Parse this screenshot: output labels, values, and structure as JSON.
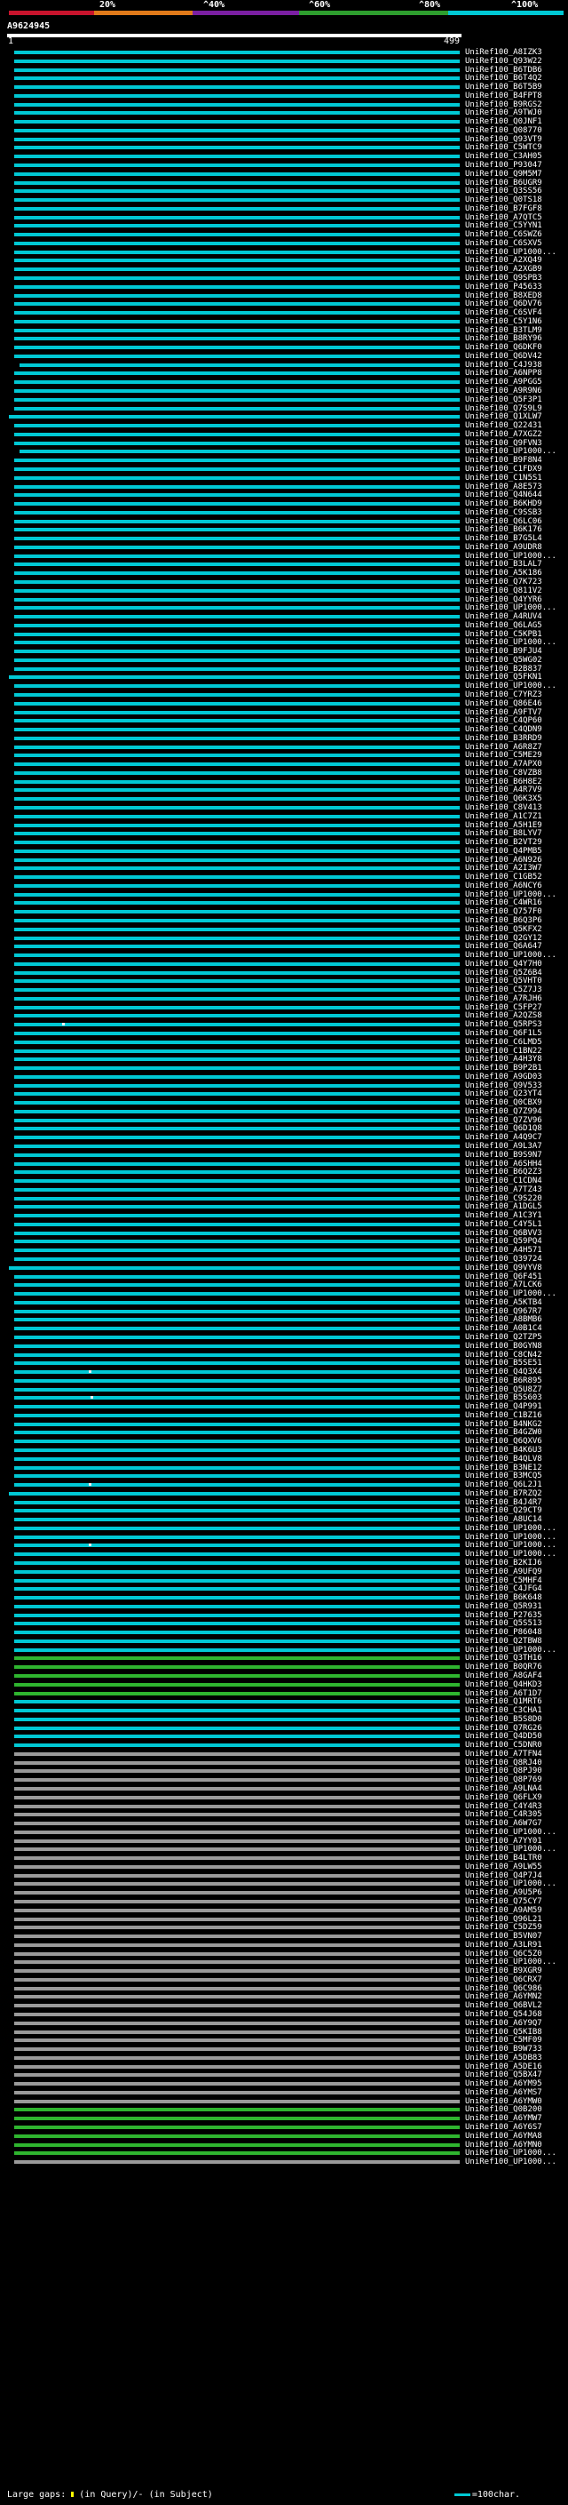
{
  "query": {
    "id": "A9624945",
    "start": "1",
    "end": "499"
  },
  "scale": {
    "ticks": [
      "20%",
      "^40%",
      "^60%",
      "^80%",
      "^100%"
    ],
    "bands": [
      "#c8142d",
      "#e07a1a",
      "#7b1fa2",
      "#2e9e2e",
      "#00c8d4"
    ]
  },
  "colors": {
    "hit": "#00c8d4",
    "hit_alt": "#2fb52f",
    "hit_gray": "#9a9a9a"
  },
  "legend": {
    "large_gaps": "Large gaps:",
    "in_query": "(in Query)/- (in Subject)",
    "scale": "=100char."
  },
  "hits": [
    "UniRef100_A8IZK3",
    "UniRef100_Q93W22",
    "UniRef100_B6TDB6",
    "UniRef100_B6T4Q2",
    "UniRef100_B6T5B9",
    "UniRef100_B4FPT8",
    "UniRef100_B9RGS2",
    "UniRef100_A9TWJ0",
    "UniRef100_Q0JNF1",
    "UniRef100_Q08770",
    "UniRef100_Q93VT9",
    "UniRef100_C5WTC9",
    "UniRef100_C3AH05",
    "UniRef100_P93047",
    "UniRef100_Q9M5M7",
    "UniRef100_B6UGR9",
    "UniRef100_Q3SS56",
    "UniRef100_Q0TS18",
    "UniRef100_B7FGF8",
    "UniRef100_A7QTC5",
    "UniRef100_C5YYN1",
    "UniRef100_C6SWZ6",
    "UniRef100_C6SXV5",
    "UniRef100_UP1000...",
    "UniRef100_A2XQ49",
    "UniRef100_A2XGB9",
    "UniRef100_Q9SPB3",
    "UniRef100_P45633",
    "UniRef100_B8XED8",
    "UniRef100_Q6DV76",
    "UniRef100_C6SVF4",
    "UniRef100_C5Y1N6",
    "UniRef100_B3TLM9",
    "UniRef100_B8RY96",
    "UniRef100_Q6DKF0",
    "UniRef100_Q6DV42",
    "UniRef100_C4J938",
    "UniRef100_A6NPP8",
    "UniRef100_A9PGG5",
    "UniRef100_A9R9N6",
    "UniRef100_Q5F3P1",
    "UniRef100_Q7S9L9",
    "UniRef100_Q1XLW7",
    "UniRef100_Q22431",
    "UniRef100_A7XGZ2",
    "UniRef100_Q9FVN3",
    "UniRef100_UP1000...",
    "UniRef100_B9F8N4",
    "UniRef100_C1FDX9",
    "UniRef100_C1N5S1",
    "UniRef100_A8E573",
    "UniRef100_Q4N644",
    "UniRef100_B6KHD9",
    "UniRef100_C9SSB3",
    "UniRef100_Q6LC06",
    "UniRef100_B6K176",
    "UniRef100_B7G5L4",
    "UniRef100_A9UDR8",
    "UniRef100_UP1000...",
    "UniRef100_B3LAL7",
    "UniRef100_A5K186",
    "UniRef100_Q7K723",
    "UniRef100_Q811V2",
    "UniRef100_Q4YYR6",
    "UniRef100_UP1000...",
    "UniRef100_A4RUV4",
    "UniRef100_Q6LAG5",
    "UniRef100_C5KPB1",
    "UniRef100_UP1000...",
    "UniRef100_B9FJU4",
    "UniRef100_Q5WG02",
    "UniRef100_B2B837",
    "UniRef100_Q5FKN1",
    "UniRef100_UP1000...",
    "UniRef100_C7YRZ3",
    "UniRef100_Q86E46",
    "UniRef100_A9FTV7",
    "UniRef100_C4QP60",
    "UniRef100_C4QDN9",
    "UniRef100_B3RRD9",
    "UniRef100_A6R8Z7",
    "UniRef100_C5ME29",
    "UniRef100_A7APX0",
    "UniRef100_C8VZB8",
    "UniRef100_B6H8E2",
    "UniRef100_A4R7V9",
    "UniRef100_Q6K3X5",
    "UniRef100_C8V413",
    "UniRef100_A1C7Z1",
    "UniRef100_A5H1E9",
    "UniRef100_B8LYV7",
    "UniRef100_B2VT29",
    "UniRef100_Q4PMB5",
    "UniRef100_A6N926",
    "UniRef100_A2I3W7",
    "UniRef100_C1GB52",
    "UniRef100_A6NCY6",
    "UniRef100_UP1000...",
    "UniRef100_C4WR16",
    "UniRef100_Q757F0",
    "UniRef100_B6Q3P6",
    "UniRef100_Q5KFX2",
    "UniRef100_Q2GY12",
    "UniRef100_Q6A647",
    "UniRef100_UP1000...",
    "UniRef100_Q4Y7H0",
    "UniRef100_Q5Z6B4",
    "UniRef100_Q5VHT0",
    "UniRef100_C5Z7J3",
    "UniRef100_A7RJH6",
    "UniRef100_C5FP27",
    "UniRef100_A2QZS8",
    "UniRef100_Q5RPS3",
    "UniRef100_Q6F1L5",
    "UniRef100_C6LMD5",
    "UniRef100_C1BN22",
    "UniRef100_A4H3Y8",
    "UniRef100_B9P2B1",
    "UniRef100_A9GD03",
    "UniRef100_Q9V533",
    "UniRef100_Q23YT4",
    "UniRef100_Q0CBX9",
    "UniRef100_Q7Z994",
    "UniRef100_Q7ZV96",
    "UniRef100_Q6D1Q8",
    "UniRef100_A4Q9C7",
    "UniRef100_A9L3A7",
    "UniRef100_B9S9N7",
    "UniRef100_A6SHH4",
    "UniRef100_B6Q2Z3",
    "UniRef100_C1CDN4",
    "UniRef100_A7TZ43",
    "UniRef100_C9S220",
    "UniRef100_A1DGL5",
    "UniRef100_A1C3Y1",
    "UniRef100_C4Y5L1",
    "UniRef100_Q6BVV3",
    "UniRef100_Q59PQ4",
    "UniRef100_A4H571",
    "UniRef100_Q39724",
    "UniRef100_Q9VYV8",
    "UniRef100_Q6F451",
    "UniRef100_A7LCK6",
    "UniRef100_UP1000...",
    "UniRef100_A5KTB4",
    "UniRef100_Q967R7",
    "UniRef100_A8BMB6",
    "UniRef100_A0B1C4",
    "UniRef100_Q2TZP5",
    "UniRef100_B0GYN8",
    "UniRef100_C8CN42",
    "UniRef100_B5SE51",
    "UniRef100_Q4Q3X4",
    "UniRef100_B6R895",
    "UniRef100_Q5U8Z7",
    "UniRef100_B5S603",
    "UniRef100_Q4P991",
    "UniRef100_C1BZ16",
    "UniRef100_B4NKG2",
    "UniRef100_B4GZW0",
    "UniRef100_Q6QXV6",
    "UniRef100_B4K6U3",
    "UniRef100_B4QLV8",
    "UniRef100_B3NE12",
    "UniRef100_B3MCQ5",
    "UniRef100_Q6L2J1",
    "UniRef100_B7RZQ2",
    "UniRef100_B4J4R7",
    "UniRef100_Q29CT9",
    "UniRef100_A8UC14",
    "UniRef100_UP1000...",
    "UniRef100_UP1000...",
    "UniRef100_UP1000...",
    "UniRef100_UP1000...",
    "UniRef100_B2KIJ6",
    "UniRef100_A9UFQ9",
    "UniRef100_C5MHF4",
    "UniRef100_C4JFG4",
    "UniRef100_B6K648",
    "UniRef100_Q5R931",
    "UniRef100_P27635",
    "UniRef100_Q5S513",
    "UniRef100_P86048",
    "UniRef100_Q2TBW8",
    "UniRef100_UP1000...",
    "UniRef100_Q3TH16",
    "UniRef100_B0QR76",
    "UniRef100_A8GAF4",
    "UniRef100_Q4HKD3",
    "UniRef100_A6T1D7",
    "UniRef100_Q1MRT6",
    "UniRef100_C3CHA1",
    "UniRef100_B5S8D0",
    "UniRef100_Q7RG26",
    "UniRef100_Q4DD50",
    "UniRef100_C5DNR0",
    "UniRef100_A7TFN4",
    "UniRef100_Q8RJ40",
    "UniRef100_Q8PJ90",
    "UniRef100_Q8P769",
    "UniRef100_A9LNA4",
    "UniRef100_Q6FLX9",
    "UniRef100_C4Y4R3",
    "UniRef100_C4R305",
    "UniRef100_A6W7G7",
    "UniRef100_UP1000...",
    "UniRef100_A7YY01",
    "UniRef100_UP1000...",
    "UniRef100_B4LTR0",
    "UniRef100_A9LW55",
    "UniRef100_Q4P7J4",
    "UniRef100_UP1000...",
    "UniRef100_A9U5P6",
    "UniRef100_Q75CY7",
    "UniRef100_A9AM59",
    "UniRef100_Q96L21",
    "UniRef100_C5DZ59",
    "UniRef100_B5VN07",
    "UniRef100_A3LR91",
    "UniRef100_Q6C5Z0",
    "UniRef100_UP1000...",
    "UniRef100_B9XGR9",
    "UniRef100_Q6CRX7",
    "UniRef100_Q6C986",
    "UniRef100_A6YMN2",
    "UniRef100_Q6BVL2",
    "UniRef100_Q54J68",
    "UniRef100_A6Y9Q7",
    "UniRef100_Q5KIB8",
    "UniRef100_C5MF09",
    "UniRef100_B9W733",
    "UniRef100_A5DB83",
    "UniRef100_A5DE16",
    "UniRef100_Q5BX47",
    "UniRef100_A6YM95",
    "UniRef100_A6YMS7",
    "UniRef100_A6YMW0",
    "UniRef100_Q0B200",
    "UniRef100_A6YMW7",
    "UniRef100_A6Y6S7",
    "UniRef100_A6YMA8",
    "UniRef100_A6YMN0",
    "UniRef100_UP1000...",
    "UniRef100_UP1000..."
  ]
}
